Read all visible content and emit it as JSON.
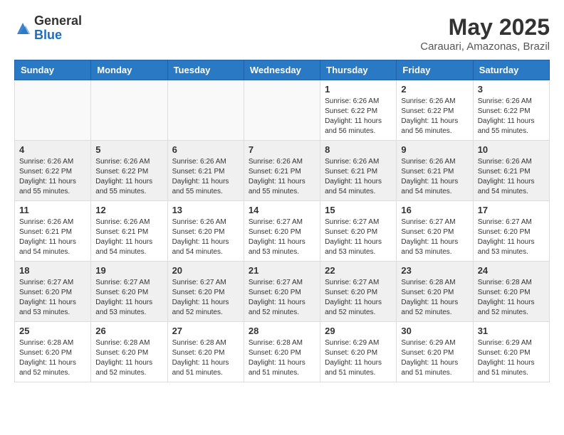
{
  "header": {
    "logo_general": "General",
    "logo_blue": "Blue",
    "month_year": "May 2025",
    "location": "Carauari, Amazonas, Brazil"
  },
  "days_of_week": [
    "Sunday",
    "Monday",
    "Tuesday",
    "Wednesday",
    "Thursday",
    "Friday",
    "Saturday"
  ],
  "weeks": [
    [
      {
        "day": "",
        "info": ""
      },
      {
        "day": "",
        "info": ""
      },
      {
        "day": "",
        "info": ""
      },
      {
        "day": "",
        "info": ""
      },
      {
        "day": "1",
        "info": "Sunrise: 6:26 AM\nSunset: 6:22 PM\nDaylight: 11 hours\nand 56 minutes."
      },
      {
        "day": "2",
        "info": "Sunrise: 6:26 AM\nSunset: 6:22 PM\nDaylight: 11 hours\nand 56 minutes."
      },
      {
        "day": "3",
        "info": "Sunrise: 6:26 AM\nSunset: 6:22 PM\nDaylight: 11 hours\nand 55 minutes."
      }
    ],
    [
      {
        "day": "4",
        "info": "Sunrise: 6:26 AM\nSunset: 6:22 PM\nDaylight: 11 hours\nand 55 minutes."
      },
      {
        "day": "5",
        "info": "Sunrise: 6:26 AM\nSunset: 6:22 PM\nDaylight: 11 hours\nand 55 minutes."
      },
      {
        "day": "6",
        "info": "Sunrise: 6:26 AM\nSunset: 6:21 PM\nDaylight: 11 hours\nand 55 minutes."
      },
      {
        "day": "7",
        "info": "Sunrise: 6:26 AM\nSunset: 6:21 PM\nDaylight: 11 hours\nand 55 minutes."
      },
      {
        "day": "8",
        "info": "Sunrise: 6:26 AM\nSunset: 6:21 PM\nDaylight: 11 hours\nand 54 minutes."
      },
      {
        "day": "9",
        "info": "Sunrise: 6:26 AM\nSunset: 6:21 PM\nDaylight: 11 hours\nand 54 minutes."
      },
      {
        "day": "10",
        "info": "Sunrise: 6:26 AM\nSunset: 6:21 PM\nDaylight: 11 hours\nand 54 minutes."
      }
    ],
    [
      {
        "day": "11",
        "info": "Sunrise: 6:26 AM\nSunset: 6:21 PM\nDaylight: 11 hours\nand 54 minutes."
      },
      {
        "day": "12",
        "info": "Sunrise: 6:26 AM\nSunset: 6:21 PM\nDaylight: 11 hours\nand 54 minutes."
      },
      {
        "day": "13",
        "info": "Sunrise: 6:26 AM\nSunset: 6:20 PM\nDaylight: 11 hours\nand 54 minutes."
      },
      {
        "day": "14",
        "info": "Sunrise: 6:27 AM\nSunset: 6:20 PM\nDaylight: 11 hours\nand 53 minutes."
      },
      {
        "day": "15",
        "info": "Sunrise: 6:27 AM\nSunset: 6:20 PM\nDaylight: 11 hours\nand 53 minutes."
      },
      {
        "day": "16",
        "info": "Sunrise: 6:27 AM\nSunset: 6:20 PM\nDaylight: 11 hours\nand 53 minutes."
      },
      {
        "day": "17",
        "info": "Sunrise: 6:27 AM\nSunset: 6:20 PM\nDaylight: 11 hours\nand 53 minutes."
      }
    ],
    [
      {
        "day": "18",
        "info": "Sunrise: 6:27 AM\nSunset: 6:20 PM\nDaylight: 11 hours\nand 53 minutes."
      },
      {
        "day": "19",
        "info": "Sunrise: 6:27 AM\nSunset: 6:20 PM\nDaylight: 11 hours\nand 53 minutes."
      },
      {
        "day": "20",
        "info": "Sunrise: 6:27 AM\nSunset: 6:20 PM\nDaylight: 11 hours\nand 52 minutes."
      },
      {
        "day": "21",
        "info": "Sunrise: 6:27 AM\nSunset: 6:20 PM\nDaylight: 11 hours\nand 52 minutes."
      },
      {
        "day": "22",
        "info": "Sunrise: 6:27 AM\nSunset: 6:20 PM\nDaylight: 11 hours\nand 52 minutes."
      },
      {
        "day": "23",
        "info": "Sunrise: 6:28 AM\nSunset: 6:20 PM\nDaylight: 11 hours\nand 52 minutes."
      },
      {
        "day": "24",
        "info": "Sunrise: 6:28 AM\nSunset: 6:20 PM\nDaylight: 11 hours\nand 52 minutes."
      }
    ],
    [
      {
        "day": "25",
        "info": "Sunrise: 6:28 AM\nSunset: 6:20 PM\nDaylight: 11 hours\nand 52 minutes."
      },
      {
        "day": "26",
        "info": "Sunrise: 6:28 AM\nSunset: 6:20 PM\nDaylight: 11 hours\nand 52 minutes."
      },
      {
        "day": "27",
        "info": "Sunrise: 6:28 AM\nSunset: 6:20 PM\nDaylight: 11 hours\nand 51 minutes."
      },
      {
        "day": "28",
        "info": "Sunrise: 6:28 AM\nSunset: 6:20 PM\nDaylight: 11 hours\nand 51 minutes."
      },
      {
        "day": "29",
        "info": "Sunrise: 6:29 AM\nSunset: 6:20 PM\nDaylight: 11 hours\nand 51 minutes."
      },
      {
        "day": "30",
        "info": "Sunrise: 6:29 AM\nSunset: 6:20 PM\nDaylight: 11 hours\nand 51 minutes."
      },
      {
        "day": "31",
        "info": "Sunrise: 6:29 AM\nSunset: 6:20 PM\nDaylight: 11 hours\nand 51 minutes."
      }
    ]
  ]
}
